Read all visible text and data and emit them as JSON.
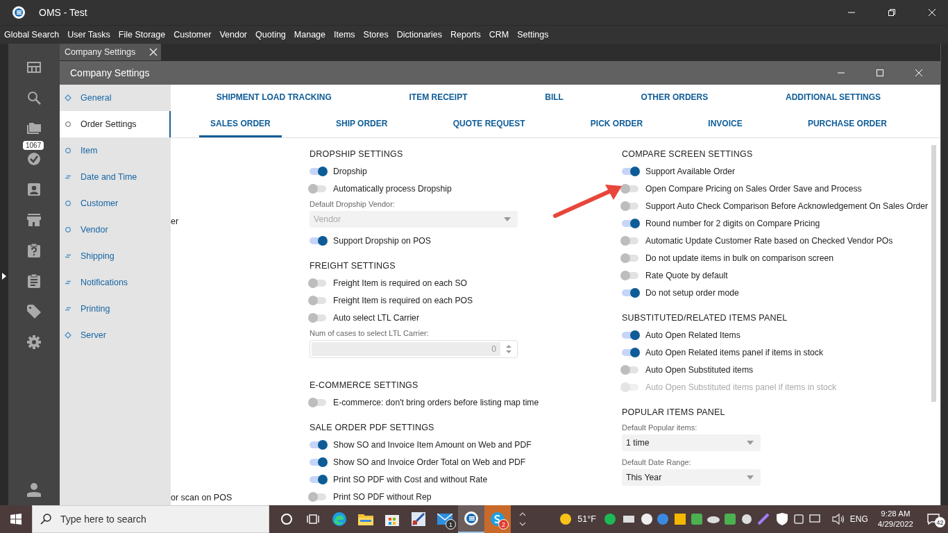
{
  "window": {
    "title": "OMS - Test"
  },
  "menu": [
    "Global Search",
    "User Tasks",
    "File Storage",
    "Customer",
    "Vendor",
    "Quoting",
    "Manage",
    "Items",
    "Stores",
    "Dictionaries",
    "Reports",
    "CRM",
    "Settings"
  ],
  "rail_badge": "1067",
  "doc_tab": {
    "label": "Company Settings"
  },
  "dialog": {
    "title": "Company Settings"
  },
  "nav": [
    {
      "label": "General",
      "kind": "group",
      "selected": false
    },
    {
      "label": "Order Settings",
      "kind": "page",
      "selected": true
    },
    {
      "label": "Item",
      "kind": "page",
      "selected": false
    },
    {
      "label": "Date and Time",
      "kind": "list",
      "selected": false
    },
    {
      "label": "Customer",
      "kind": "page",
      "selected": false
    },
    {
      "label": "Vendor",
      "kind": "page",
      "selected": false
    },
    {
      "label": "Shipping",
      "kind": "list",
      "selected": false
    },
    {
      "label": "Notifications",
      "kind": "list",
      "selected": false
    },
    {
      "label": "Printing",
      "kind": "list",
      "selected": false
    },
    {
      "label": "Server",
      "kind": "group",
      "selected": false
    }
  ],
  "tab_rows": [
    [
      {
        "label": "SHIPMENT LOAD TRACKING",
        "selected": false
      },
      {
        "label": "ITEM RECEIPT",
        "selected": false
      },
      {
        "label": "BILL",
        "selected": false
      },
      {
        "label": "OTHER ORDERS",
        "selected": false
      },
      {
        "label": "ADDITIONAL SETTINGS",
        "selected": false
      }
    ],
    [
      {
        "label": "SALES ORDER",
        "selected": true
      },
      {
        "label": "SHIP ORDER",
        "selected": false
      },
      {
        "label": "QUOTE REQUEST",
        "selected": false
      },
      {
        "label": "PICK ORDER",
        "selected": false
      },
      {
        "label": "INVOICE",
        "selected": false
      },
      {
        "label": "PURCHASE ORDER",
        "selected": false
      }
    ]
  ],
  "background_text": [
    "er",
    "or scan on POS"
  ],
  "columns": [
    [
      {
        "title": "DROPSHIP SETTINGS",
        "items": [
          {
            "kind": "toggle",
            "label": "Dropship",
            "on": true,
            "disabled": false
          },
          {
            "kind": "toggle",
            "label": "Automatically process Dropship",
            "on": false,
            "disabled": false
          },
          {
            "kind": "select",
            "label": "Default Dropship Vendor:",
            "value": "Vendor",
            "disabled": true
          },
          {
            "kind": "toggle",
            "label": "Support Dropship on POS",
            "on": true,
            "disabled": false
          }
        ]
      },
      {
        "title": "FREIGHT SETTINGS",
        "items": [
          {
            "kind": "toggle",
            "label": "Freight Item is required on each SO",
            "on": false,
            "disabled": false
          },
          {
            "kind": "toggle",
            "label": "Freight Item is required on each POS",
            "on": false,
            "disabled": false
          },
          {
            "kind": "toggle",
            "label": "Auto select LTL Carrier",
            "on": false,
            "disabled": false
          },
          {
            "kind": "number",
            "label": "Num of cases to select LTL Carrier:",
            "value": "0",
            "disabled": true
          }
        ]
      },
      {
        "title": "E-COMMERCE SETTINGS",
        "items": [
          {
            "kind": "toggle",
            "label": "E-commerce: don't bring orders before listing map time",
            "on": false,
            "disabled": false
          }
        ]
      },
      {
        "title": "SALE ORDER PDF SETTINGS",
        "items": [
          {
            "kind": "toggle",
            "label": "Show SO and Invoice Item Amount on Web and PDF",
            "on": true,
            "disabled": false
          },
          {
            "kind": "toggle",
            "label": "Show SO and Invoice Order Total on Web and PDF",
            "on": true,
            "disabled": false
          },
          {
            "kind": "toggle",
            "label": "Print SO PDF with Cost and without Rate",
            "on": true,
            "disabled": false
          },
          {
            "kind": "toggle",
            "label": "Print SO PDF without Rep",
            "on": false,
            "disabled": false
          }
        ]
      }
    ],
    [
      {
        "title": "COMPARE SCREEN SETTINGS",
        "items": [
          {
            "kind": "toggle",
            "label": "Support Available Order",
            "on": true,
            "disabled": false
          },
          {
            "kind": "toggle",
            "label": "Open Compare Pricing on Sales Order Save and Process",
            "on": false,
            "disabled": false
          },
          {
            "kind": "toggle",
            "label": "Support Auto Check Comparison Before Acknowledgement On Sales Order",
            "on": false,
            "disabled": false
          },
          {
            "kind": "toggle",
            "label": "Round number for 2 digits on Compare Pricing",
            "on": true,
            "disabled": false
          },
          {
            "kind": "toggle",
            "label": "Automatic Update Customer Rate based on Checked Vendor POs",
            "on": false,
            "disabled": false
          },
          {
            "kind": "toggle",
            "label": "Do not update items in bulk on comparison screen",
            "on": false,
            "disabled": false
          },
          {
            "kind": "toggle",
            "label": "Rate Quote by default",
            "on": false,
            "disabled": false
          },
          {
            "kind": "toggle",
            "label": "Do not setup order mode",
            "on": true,
            "disabled": false
          }
        ]
      },
      {
        "title": "SUBSTITUTED/RELATED ITEMS PANEL",
        "items": [
          {
            "kind": "toggle",
            "label": "Auto Open Related Items",
            "on": true,
            "disabled": false
          },
          {
            "kind": "toggle",
            "label": "Auto Open Related items panel if items in stock",
            "on": true,
            "disabled": false
          },
          {
            "kind": "toggle",
            "label": "Auto Open Substituted items",
            "on": false,
            "disabled": false
          },
          {
            "kind": "toggle",
            "label": "Auto Open Substituted items panel if items in stock",
            "on": false,
            "disabled": true
          }
        ]
      },
      {
        "title": "POPULAR ITEMS PANEL",
        "items": [
          {
            "kind": "select",
            "label": "Default Popular items:",
            "value": "1 time",
            "disabled": false
          },
          {
            "kind": "select",
            "label": "Default Date Range:",
            "value": "This Year",
            "disabled": false
          }
        ]
      }
    ]
  ],
  "taskbar": {
    "search_placeholder": "Type here to search",
    "apps": [
      {
        "kind": "cortana",
        "selected": false
      },
      {
        "kind": "taskview",
        "selected": false
      },
      {
        "kind": "edge",
        "selected": false
      },
      {
        "kind": "explorer",
        "selected": false
      },
      {
        "kind": "store",
        "selected": false
      },
      {
        "kind": "paint",
        "selected": false
      },
      {
        "kind": "mail",
        "badge": "1",
        "selected": false
      },
      {
        "kind": "oms",
        "selected": true
      },
      {
        "kind": "skype",
        "badge": "2",
        "selected": false
      }
    ],
    "weather": "51°F",
    "language": "ENG",
    "time": "9:28 AM",
    "date": "4/29/2022",
    "notifications": "42"
  }
}
